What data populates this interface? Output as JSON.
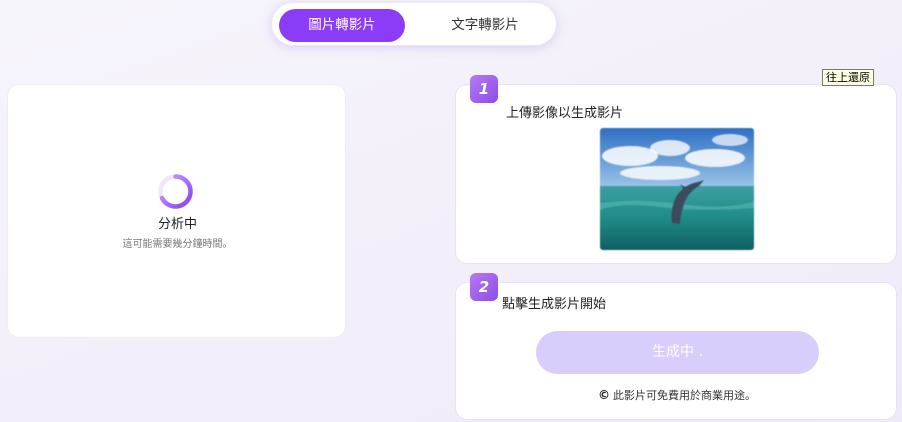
{
  "tabs": {
    "image_to_video": "圖片轉影片",
    "text_to_video": "文字轉影片"
  },
  "status": {
    "title": "分析中",
    "subtitle": "這可能需要幾分鐘時間。"
  },
  "step1": {
    "number": "1",
    "title": "上傳影像以生成影片"
  },
  "step2": {
    "number": "2",
    "title": "點擊生成影片開始",
    "button_label": "生成中 .",
    "footnote": "此影片可免費用於商業用途。"
  },
  "tooltip": "往上還原",
  "colors": {
    "accent": "#8b3cf7",
    "button_disabled": "#d9cdfb"
  },
  "icons": {
    "spinner": "loading-spinner-icon",
    "copyright": "copyright-icon"
  }
}
